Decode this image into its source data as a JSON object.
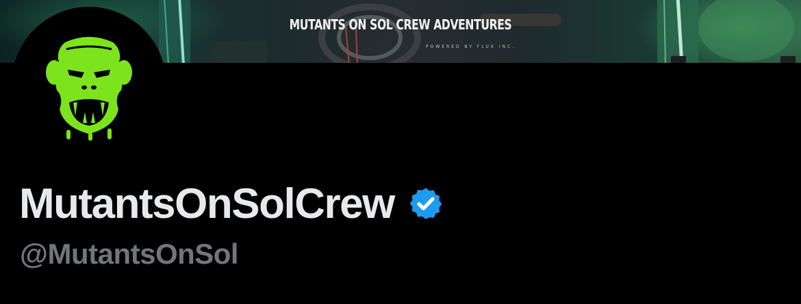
{
  "banner": {
    "title": "MUTANTS ON SOL CREW ADVENTURES",
    "subtitle": "POWERED BY FLUX INC."
  },
  "avatar": {
    "icon": "mutant-ape-logo-icon",
    "accent": "#7ce31d"
  },
  "profile": {
    "display_name": "MutantsOnSolCrew",
    "handle": "@MutantsOnSol",
    "verified": true,
    "verified_color": "#1d9bf0"
  },
  "colors": {
    "background": "#000000",
    "name_text": "#e7e9ea",
    "handle_text": "#71767b"
  }
}
